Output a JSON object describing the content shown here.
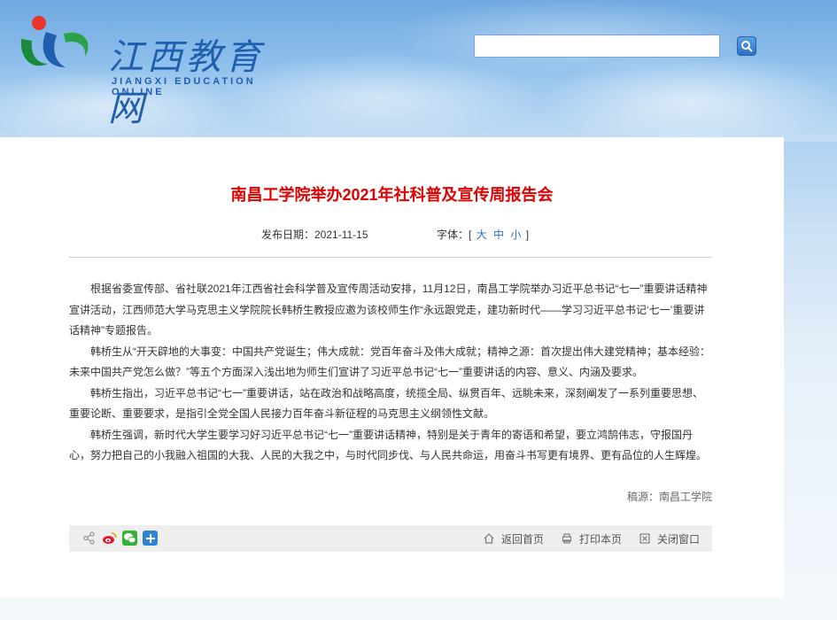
{
  "header": {
    "logo_cn": "江西教育网",
    "logo_en": "JIANGXI EDUCATION ONLINE",
    "search": {
      "placeholder": "",
      "value": ""
    },
    "search_button_icon": "search-icon"
  },
  "article": {
    "title": "南昌工学院举办2021年社科普及宣传周报告会",
    "date_label": "发布日期：2021-11-15",
    "font_label": "字体：[",
    "font_sizes": [
      "大",
      "中",
      "小"
    ],
    "font_close": "]",
    "paragraphs": [
      "根据省委宣传部、省社联2021年江西省社会科学普及宣传周活动安排，11月12日，南昌工学院举办习近平总书记“七一”重要讲话精神宣讲活动，江西师范大学马克思主义学院院长韩桥生教授应邀为该校师生作“永远跟党走，建功新时代——学习习近平总书记‘七一’重要讲话精神”专题报告。",
      "韩桥生从“开天辟地的大事变：中国共产党诞生；伟大成就：党百年奋斗及伟大成就；精神之源：首次提出伟大建党精神；基本经验：未来中国共产党怎么做？”等五个方面深入浅出地为师生们宣讲了习近平总书记“七一”重要讲话的内容、意义、内涵及要求。",
      "韩桥生指出，习近平总书记“七一”重要讲话，站在政治和战略高度，统揽全局、纵贯百年、远眺未来，深刻阐发了一系列重要思想、重要论断、重要要求，是指引全党全国人民接力百年奋斗新征程的马克思主义纲领性文献。",
      "韩桥生强调，新时代大学生要学习好习近平总书记“七一”重要讲话精神，特别是关于青年的寄语和希望，要立鸿鹄伟志，守报国丹心，努力把自己的小我融入祖国的大我、人民的大我之中，与时代同步伐、与人民共命运，用奋斗书写更有境界、更有品位的人生辉煌。"
    ],
    "source": "稿源：南昌工学院"
  },
  "toolbar": {
    "share_icons": [
      "share-icon",
      "weibo-icon",
      "wechat-icon",
      "plus-icon"
    ],
    "home": "返回首页",
    "print": "打印本页",
    "close": "关闭窗口"
  },
  "colors": {
    "title": "#e00000",
    "link": "#2b6fc1"
  }
}
